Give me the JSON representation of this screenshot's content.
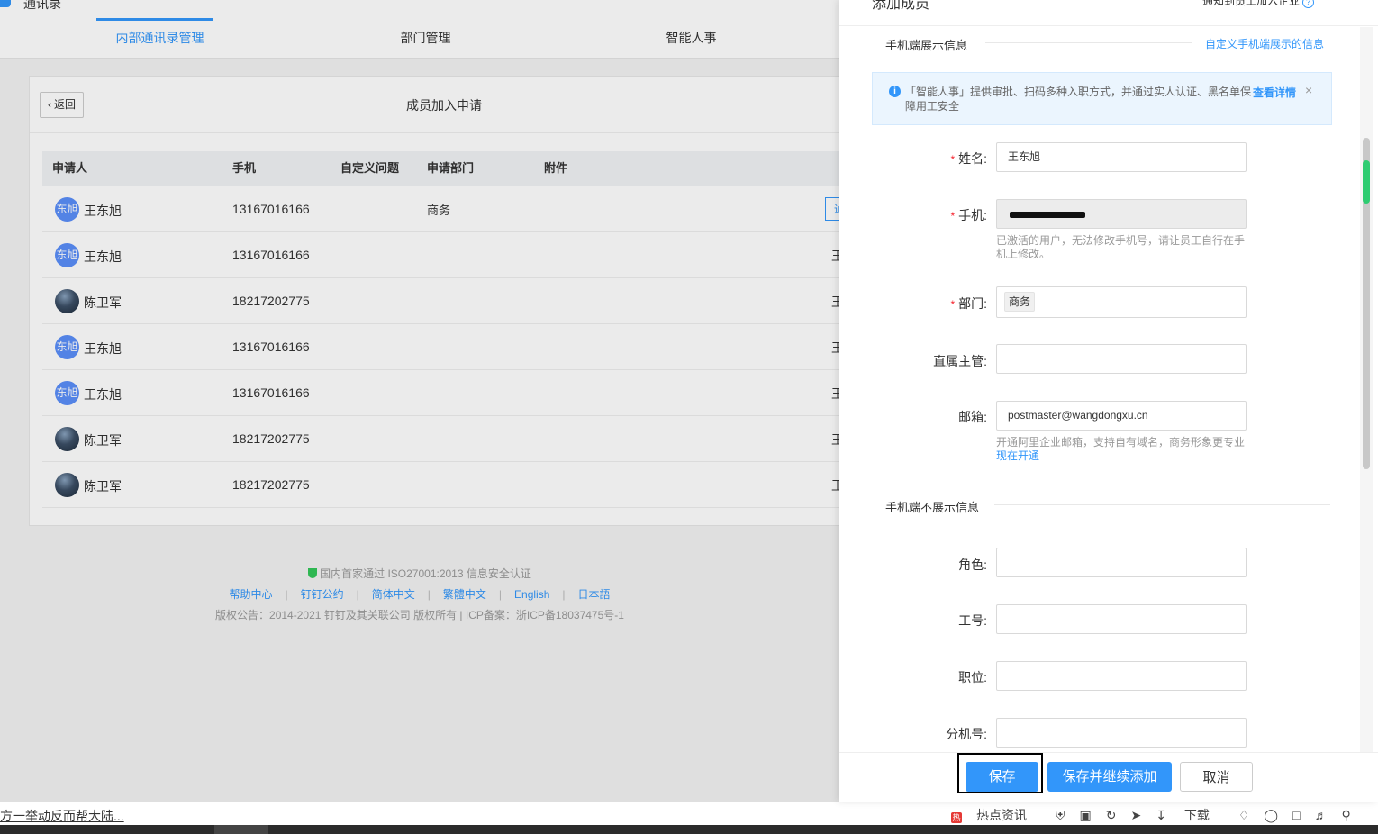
{
  "app": {
    "name": "通讯录"
  },
  "nav": {
    "tabs": [
      "内部通讯录管理",
      "部门管理",
      "智能人事"
    ],
    "active": 0
  },
  "card": {
    "back_label": "返回",
    "title": "成员加入申请",
    "columns": [
      "申请人",
      "手机",
      "自定义问题",
      "申请部门",
      "附件"
    ],
    "rows": [
      {
        "avatar_text": "东旭",
        "avatar_type": "text",
        "name": "王东旭",
        "phone": "13167016166",
        "dept": "商务",
        "stub": "通"
      },
      {
        "avatar_text": "东旭",
        "avatar_type": "text",
        "name": "王东旭",
        "phone": "13167016166",
        "dept": "",
        "stub": "王"
      },
      {
        "avatar_text": "",
        "avatar_type": "img",
        "name": "陈卫军",
        "phone": "18217202775",
        "dept": "",
        "stub": "王"
      },
      {
        "avatar_text": "东旭",
        "avatar_type": "text",
        "name": "王东旭",
        "phone": "13167016166",
        "dept": "",
        "stub": "王"
      },
      {
        "avatar_text": "东旭",
        "avatar_type": "text",
        "name": "王东旭",
        "phone": "13167016166",
        "dept": "",
        "stub": "王"
      },
      {
        "avatar_text": "",
        "avatar_type": "img",
        "name": "陈卫军",
        "phone": "18217202775",
        "dept": "",
        "stub": "王"
      },
      {
        "avatar_text": "",
        "avatar_type": "img",
        "name": "陈卫军",
        "phone": "18217202775",
        "dept": "",
        "stub": "王"
      }
    ]
  },
  "footer": {
    "cert": "国内首家通过 ISO27001:2013 信息安全认证",
    "links": [
      "帮助中心",
      "钉钉公约",
      "简体中文",
      "繁體中文",
      "English",
      "日本語"
    ],
    "copyright": "版权公告：2014-2021 钉钉及其关联公司 版权所有 | ICP备案：浙ICP备18037475号-1"
  },
  "drawer": {
    "title": "添加成员",
    "hint": "通知到员工加入企业",
    "section_mobile": "手机端展示信息",
    "section_mobile_link": "自定义手机端展示的信息",
    "info_text": "「智能人事」提供审批、扫码多种入职方式，并通过实人认证、黑名单保障用工安全",
    "info_link": "查看详情",
    "info_close": "×",
    "fields": {
      "name_label": "姓名:",
      "name_value": "王东旭",
      "phone_label": "手机:",
      "phone_help": "已激活的用户，无法修改手机号，请让员工自行在手机上修改。",
      "dept_label": "部门:",
      "dept_value": "商务",
      "manager_label": "直属主管:",
      "email_label": "邮箱:",
      "email_value": "postmaster@wangdongxu.cn",
      "email_help": "开通阿里企业邮箱，支持自有域名，商务形象更专业",
      "email_help_link": "现在开通"
    },
    "section_hidden": "手机端不展示信息",
    "hidden_fields": {
      "role_label": "角色:",
      "jobno_label": "工号:",
      "position_label": "职位:",
      "ext_label": "分机号:"
    },
    "buttons": {
      "save": "保存",
      "save_continue": "保存并继续添加",
      "cancel": "取消"
    }
  },
  "statusbar": {
    "news": "方一举动反而帮大陆...",
    "hot_news": "热点资讯",
    "download": "下载"
  },
  "colors": {
    "accent": "#3296fa",
    "required": "#f5222d"
  }
}
